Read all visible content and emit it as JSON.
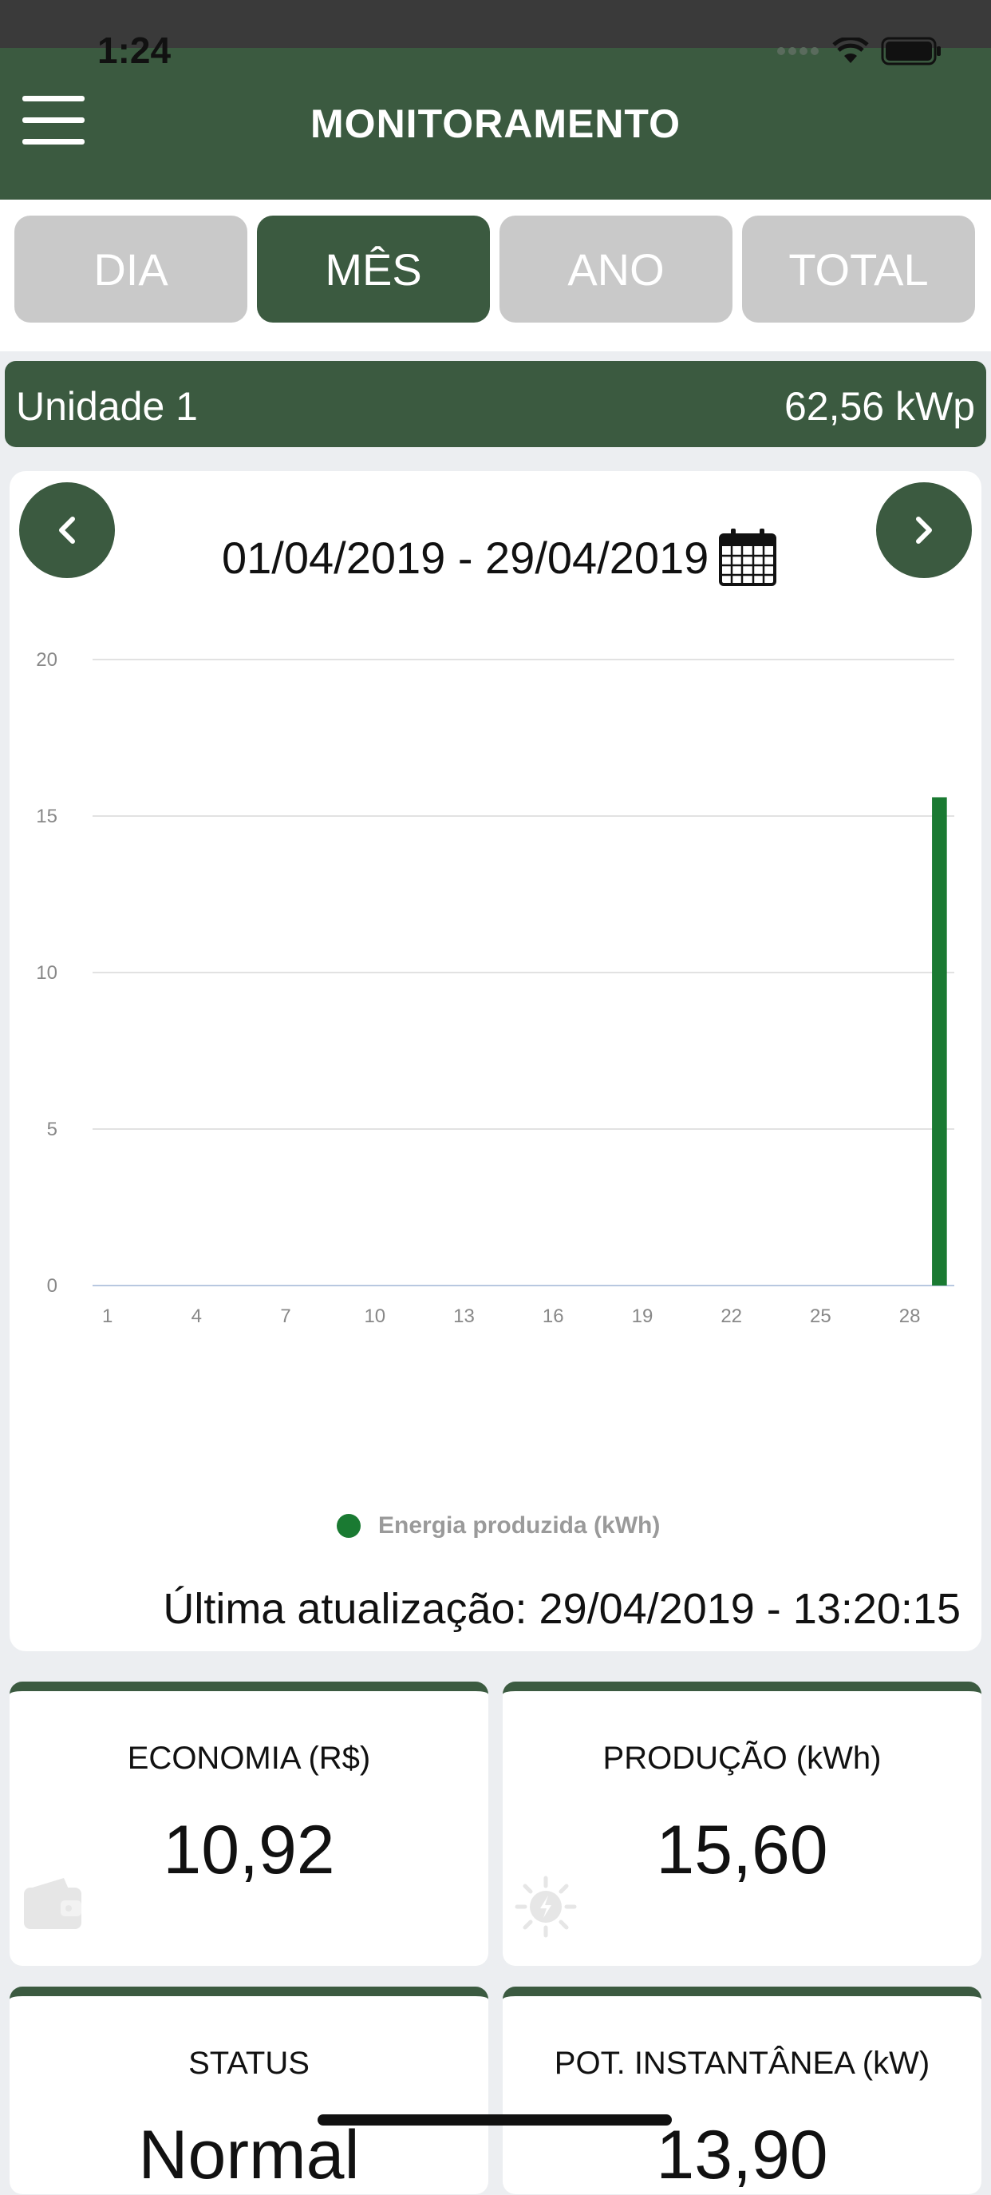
{
  "status": {
    "time": "1:24"
  },
  "header": {
    "title": "MONITORAMENTO"
  },
  "tabs": [
    {
      "label": "DIA",
      "active": false
    },
    {
      "label": "MÊS",
      "active": true
    },
    {
      "label": "ANO",
      "active": false
    },
    {
      "label": "TOTAL",
      "active": false
    }
  ],
  "unit": {
    "name": "Unidade 1",
    "power": "62,56 kWp"
  },
  "period": {
    "range": "01/04/2019 - 29/04/2019"
  },
  "chart_data": {
    "type": "bar",
    "x": [
      1,
      2,
      3,
      4,
      5,
      6,
      7,
      8,
      9,
      10,
      11,
      12,
      13,
      14,
      15,
      16,
      17,
      18,
      19,
      20,
      21,
      22,
      23,
      24,
      25,
      26,
      27,
      28,
      29
    ],
    "x_ticks": [
      "1",
      "4",
      "7",
      "10",
      "13",
      "16",
      "19",
      "22",
      "25",
      "28"
    ],
    "y_ticks": [
      "0",
      "5",
      "10",
      "15",
      "20"
    ],
    "ylim": [
      0,
      20
    ],
    "series": [
      {
        "name": "Energia produzida (kWh)",
        "color": "#1a7a32",
        "values": [
          0,
          0,
          0,
          0,
          0,
          0,
          0,
          0,
          0,
          0,
          0,
          0,
          0,
          0,
          0,
          0,
          0,
          0,
          0,
          0,
          0,
          0,
          0,
          0,
          0,
          0,
          0,
          0,
          15.6
        ]
      }
    ],
    "legend_position": "bottom",
    "grid": true
  },
  "last_update": "Última atualização: 29/04/2019 - 13:20:15",
  "kpis": [
    {
      "label": "ECONOMIA (R$)",
      "value": "10,92",
      "icon": "wallet-icon"
    },
    {
      "label": "PRODUÇÃO (kWh)",
      "value": "15,60",
      "icon": "sun-bolt-icon"
    },
    {
      "label": "STATUS",
      "value": "Normal",
      "icon": ""
    },
    {
      "label": "POT. INSTANTÂNEA (kW)",
      "value": "13,90",
      "icon": ""
    }
  ],
  "colors": {
    "primary": "#3b5a40",
    "tab_inactive": "#c9c9c9",
    "bar": "#1a7a32"
  }
}
